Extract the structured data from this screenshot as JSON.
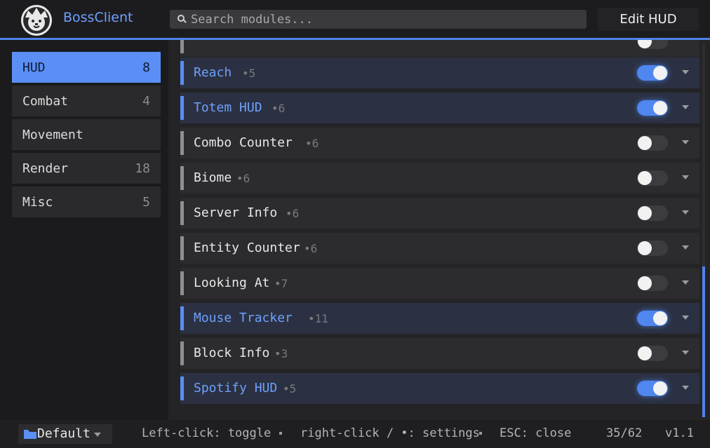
{
  "header": {
    "brand": "BossClient",
    "search_placeholder": "Search modules...",
    "edit_hud_label": "Edit HUD",
    "accent_color": "#4f83ea"
  },
  "sidebar": {
    "items": [
      {
        "label": "HUD",
        "count": "8",
        "active": true
      },
      {
        "label": "Combat",
        "count": "4",
        "active": false
      },
      {
        "label": "Movement",
        "count": "",
        "active": false
      },
      {
        "label": "Render",
        "count": "18",
        "active": false
      },
      {
        "label": "Misc",
        "count": "5",
        "active": false
      }
    ]
  },
  "modules": [
    {
      "name": "Reach",
      "settings": "•5",
      "enabled": true
    },
    {
      "name": "Totem HUD",
      "settings": "•6",
      "enabled": true
    },
    {
      "name": "Combo Counter",
      "settings": "•6",
      "enabled": false
    },
    {
      "name": "Biome",
      "settings": "•6",
      "enabled": false
    },
    {
      "name": "Server Info",
      "settings": "•6",
      "enabled": false
    },
    {
      "name": "Entity Counter",
      "settings": "•6",
      "enabled": false
    },
    {
      "name": "Looking At",
      "settings": "•7",
      "enabled": false
    },
    {
      "name": "Mouse Tracker",
      "settings": "•11",
      "enabled": true
    },
    {
      "name": "Block Info",
      "settings": "•3",
      "enabled": false
    },
    {
      "name": "Spotify HUD",
      "settings": "•5",
      "enabled": true
    }
  ],
  "footer": {
    "profile": "Default",
    "hint_toggle": "Left-click: toggle",
    "hint_settings": "right-click / •: settings",
    "hint_close": "ESC: close",
    "count": "35/62",
    "version": "v1.1"
  }
}
